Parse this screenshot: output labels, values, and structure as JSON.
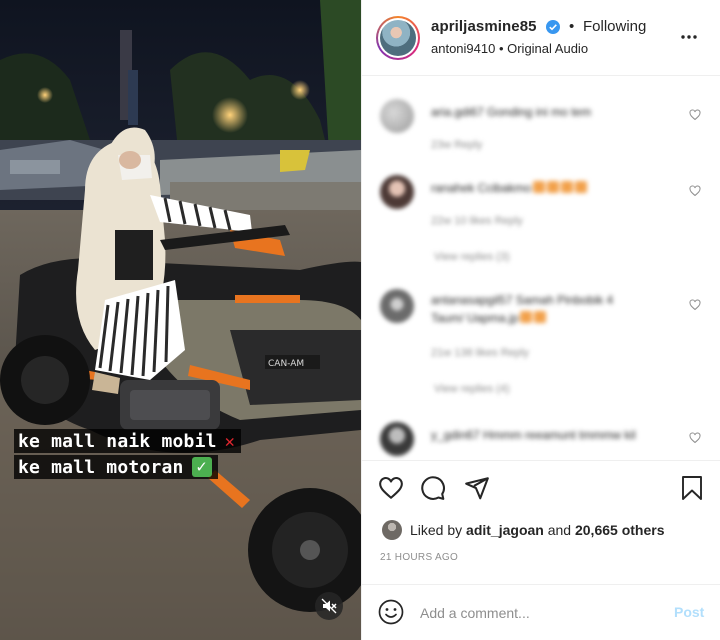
{
  "media": {
    "caption_line_1": "ke mall naik mobil",
    "caption_line_2": "ke mall motoran",
    "caption_mark_1": "✕",
    "caption_mark_2": "✓",
    "icons": [
      "mute-icon"
    ]
  },
  "header": {
    "username": "apriljasmine85",
    "separator": "•",
    "follow_status": "Following",
    "audio_line": "antoni9410 • Original Audio",
    "icons": [
      "verified-badge-icon",
      "more-options-icon"
    ]
  },
  "comments": [
    {
      "text": "aria.gdi67 Gonding ini mo tem",
      "meta": "23w   Reply",
      "replies": ""
    },
    {
      "text": "ranahek Ccibakmo",
      "meta": "22w   10 likes   Reply",
      "replies": "View replies (3)"
    },
    {
      "text": "antanasapgil57 Samah Pinbobik 4",
      "text2": "Taum/ Uapma.jp",
      "meta": "21w   138 likes   Reply",
      "replies": "View replies (4)"
    },
    {
      "text": "y_gdin67 Hmmm reeamunt tmmmw kil",
      "meta": "",
      "replies": ""
    }
  ],
  "actions": {
    "liked_prefix": "Liked by",
    "liked_user": "adit_jagoan",
    "liked_and": "and",
    "liked_others": "20,665 others",
    "timestamp": "21 HOURS AGO",
    "icons": [
      "heart-icon",
      "comment-icon",
      "share-icon",
      "bookmark-icon"
    ]
  },
  "add_comment": {
    "placeholder": "Add a comment...",
    "post_label": "Post",
    "icons": [
      "emoji-icon"
    ]
  },
  "colors": {
    "verified": "#3897f0",
    "post_button": "#b2dffc",
    "muted_text": "#8e8e8e",
    "caption_x": "#e0262e",
    "caption_check": "#4caf50",
    "bike_accent": "#e8741f"
  }
}
